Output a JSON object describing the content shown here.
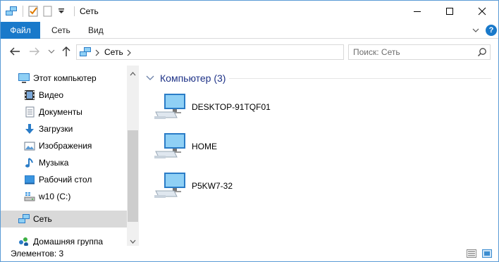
{
  "window": {
    "title": "Сеть"
  },
  "ribbon": {
    "tabs": [
      {
        "label": "Файл",
        "active": true
      },
      {
        "label": "Сеть"
      },
      {
        "label": "Вид"
      }
    ],
    "help_label": "?"
  },
  "address": {
    "crumbs": [
      "Сеть"
    ]
  },
  "search": {
    "placeholder": "Поиск: Сеть"
  },
  "sidebar": {
    "items": [
      {
        "label": "Этот компьютер",
        "icon": "computer-icon"
      },
      {
        "label": "Видео",
        "icon": "video-icon"
      },
      {
        "label": "Документы",
        "icon": "documents-icon"
      },
      {
        "label": "Загрузки",
        "icon": "downloads-icon"
      },
      {
        "label": "Изображения",
        "icon": "pictures-icon"
      },
      {
        "label": "Музыка",
        "icon": "music-icon"
      },
      {
        "label": "Рабочий стол",
        "icon": "desktop-icon"
      },
      {
        "label": "w10 (C:)",
        "icon": "drive-icon"
      },
      {
        "label": "Сеть",
        "icon": "network-icon",
        "selected": true
      },
      {
        "label": "Домашняя группа",
        "icon": "homegroup-icon"
      }
    ]
  },
  "content": {
    "group_title": "Компьютер (3)",
    "computers": [
      {
        "name": "DESKTOP-91TQF01"
      },
      {
        "name": "HOME"
      },
      {
        "name": "P5KW7-32"
      }
    ]
  },
  "status": {
    "text": "Элементов: 3"
  },
  "colors": {
    "accent": "#1979ca",
    "selection": "#d9d9d9",
    "group_title": "#1e3287"
  }
}
